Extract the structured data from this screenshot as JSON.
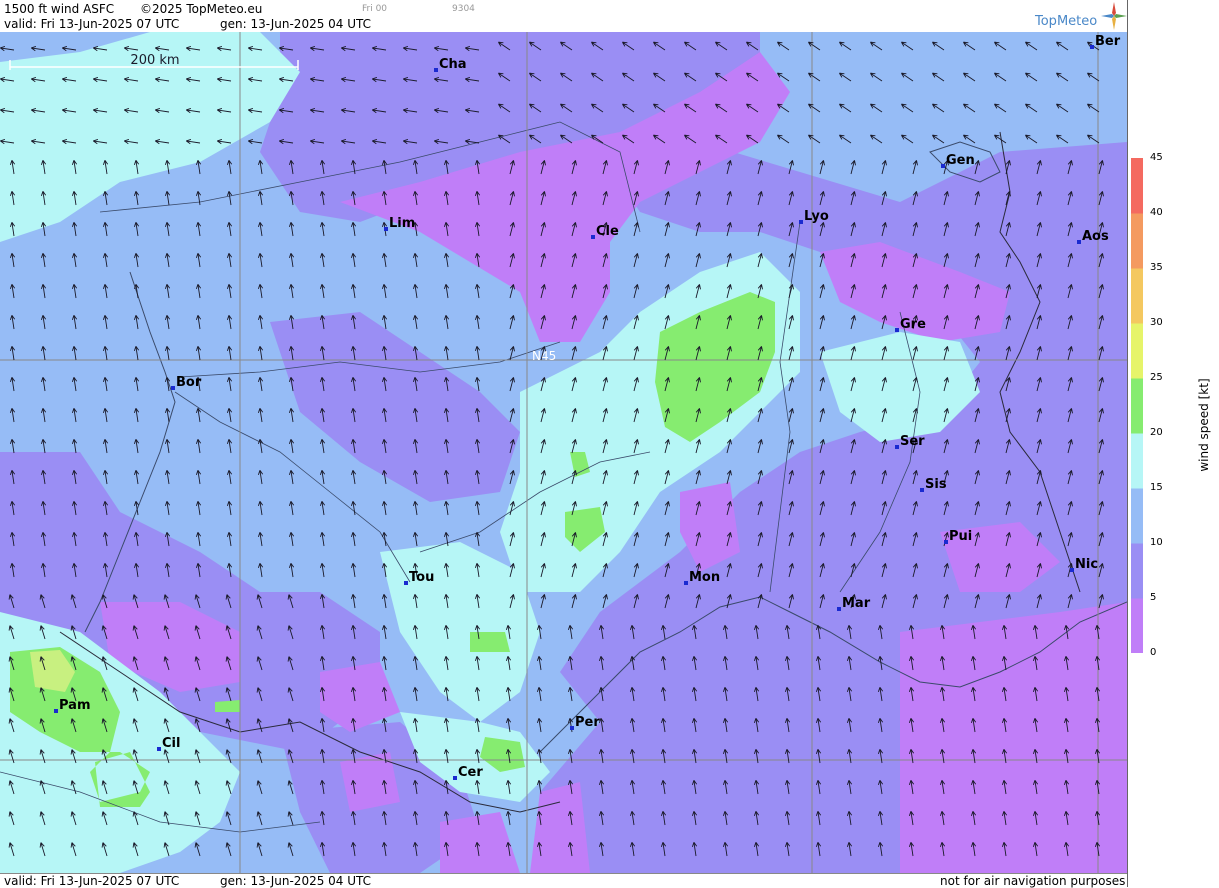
{
  "header": {
    "product": "1500 ft wind ASFC",
    "copyright": "©2025 TopMeteo.eu",
    "valid": "valid:  Fri  13-Jun-2025  07 UTC",
    "gen": "gen: 13-Jun-2025 04 UTC",
    "run": "Fri 00",
    "code": "9304",
    "logo": "TopMeteo"
  },
  "scale_bar": {
    "label": "200 km"
  },
  "map": {
    "lat_label": "N45",
    "cities": [
      {
        "id": "ber",
        "label": "Ber"
      },
      {
        "id": "cha",
        "label": "Cha"
      },
      {
        "id": "gen",
        "label": "Gen"
      },
      {
        "id": "lim",
        "label": "Lim"
      },
      {
        "id": "cle",
        "label": "Cle"
      },
      {
        "id": "lyo",
        "label": "Lyo"
      },
      {
        "id": "aos",
        "label": "Aos"
      },
      {
        "id": "gre",
        "label": "Gre"
      },
      {
        "id": "bor",
        "label": "Bor"
      },
      {
        "id": "ser",
        "label": "Ser"
      },
      {
        "id": "sis",
        "label": "Sis"
      },
      {
        "id": "pui",
        "label": "Pui"
      },
      {
        "id": "nic",
        "label": "Nic"
      },
      {
        "id": "tou",
        "label": "Tou"
      },
      {
        "id": "mon",
        "label": "Mon"
      },
      {
        "id": "mar",
        "label": "Mar"
      },
      {
        "id": "pam",
        "label": "Pam"
      },
      {
        "id": "cil",
        "label": "Cil"
      },
      {
        "id": "per",
        "label": "Per"
      },
      {
        "id": "cer",
        "label": "Cer"
      }
    ],
    "colors": {
      "calm": "#c07ef8",
      "light": "#9a8ef4",
      "moderate": "#96bcf6",
      "fresh": "#b6f6f6",
      "strong": "#86ec70",
      "very_strong": "#c8f080"
    }
  },
  "footer": {
    "valid": "valid:  Fri  13-Jun-2025  07 UTC",
    "gen": "gen: 13-Jun-2025 04 UTC",
    "disclaimer": "not for air navigation purposes"
  },
  "legend": {
    "unit": "wind  speed  [kt]",
    "range": [
      0,
      45
    ],
    "ticks": [
      0,
      5,
      10,
      15,
      20,
      25,
      30,
      35,
      40,
      45
    ],
    "colors": [
      "#c07ef8",
      "#9a8ef4",
      "#96bcf6",
      "#b6f6f6",
      "#86ec70",
      "#e6f46a",
      "#f4c860",
      "#f49a60",
      "#f46a60"
    ]
  }
}
